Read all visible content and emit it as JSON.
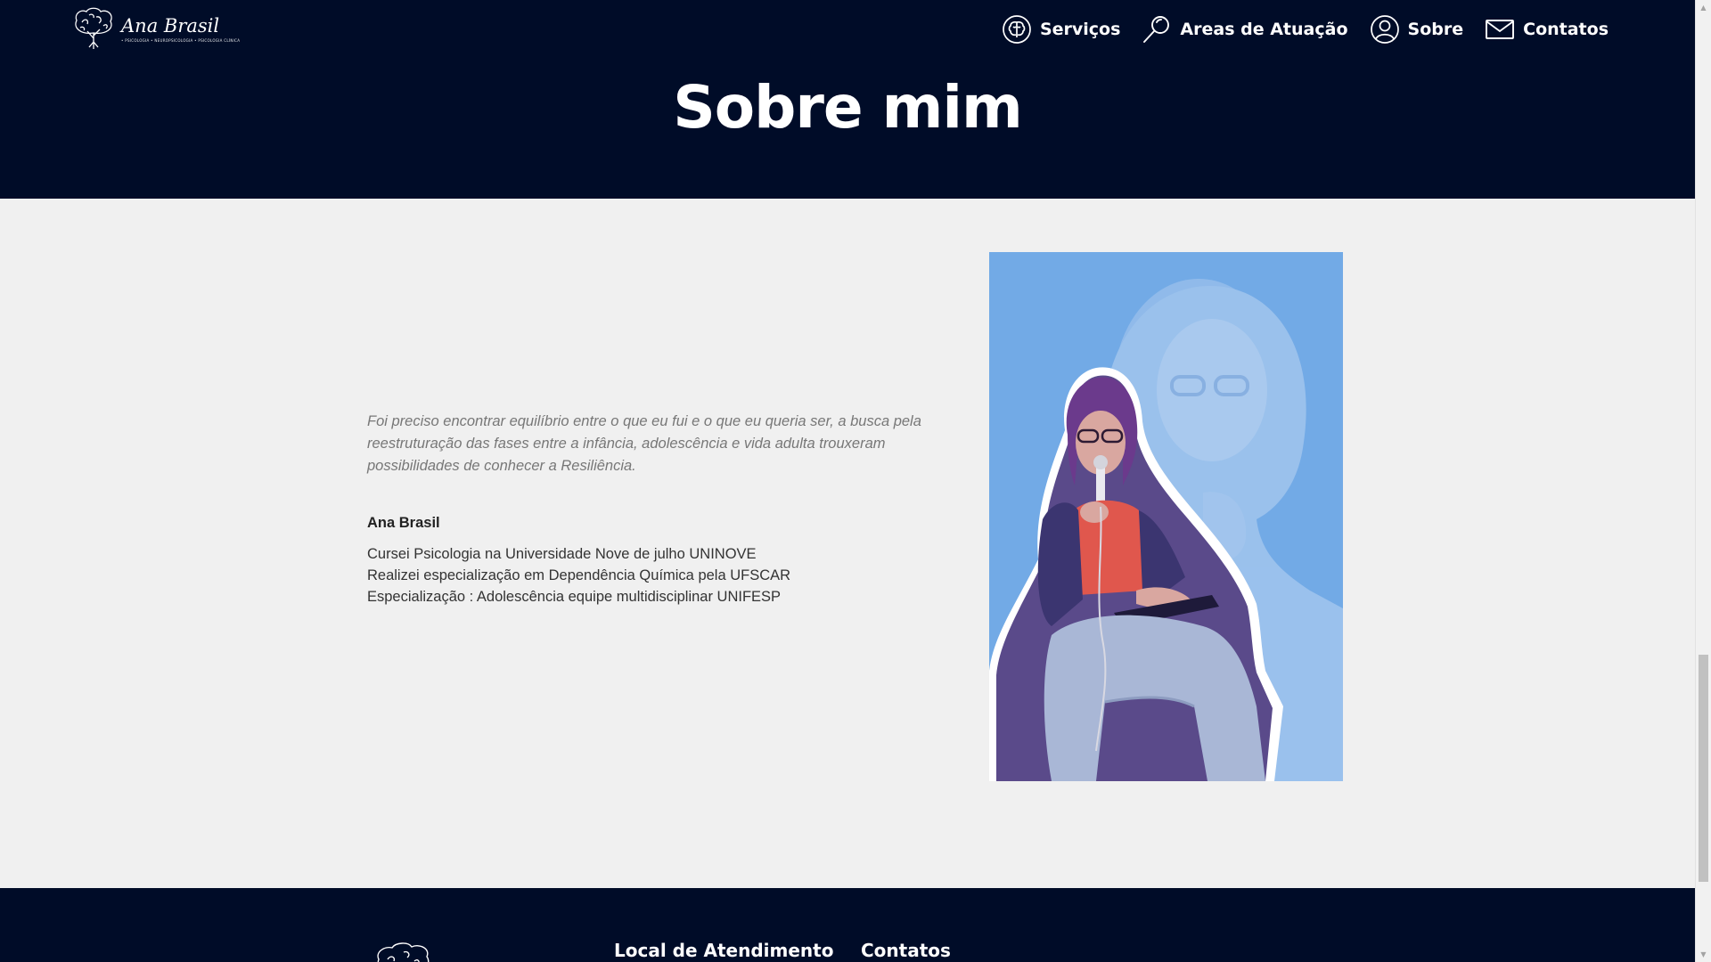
{
  "brand": {
    "name": "Ana Brasil",
    "tagline": "• PSICOLOGIA • NEUROPSICOLOGIA • PSICOLOGIA CLÍNICA"
  },
  "nav": {
    "items": [
      {
        "label": "Serviços",
        "icon": "brain-icon"
      },
      {
        "label": "Areas de Atuação",
        "icon": "search-icon"
      },
      {
        "label": "Sobre",
        "icon": "user-icon"
      },
      {
        "label": "Contatos",
        "icon": "mail-icon"
      }
    ]
  },
  "hero": {
    "title": "Sobre mim"
  },
  "about": {
    "quote": "Foi preciso encontrar equilíbrio entre o que eu fui e o que eu queria ser, a busca pela reestruturação das fases entre a infância, adolescência e vida adulta trouxeram possibilidades de conhecer a Resiliência.",
    "author": "Ana Brasil",
    "credentials": [
      "Cursei Psicologia na Universidade Nove de julho UNINOVE",
      "Realizei especialização em Dependência Química pela UFSCAR",
      "Especialização : Adolescência equipe multidisciplinar UNIFESP"
    ]
  },
  "footer": {
    "local_heading": "Local de Atendimento",
    "contact_heading": "Contatos"
  },
  "colors": {
    "navy": "#000c28",
    "background": "#f0f0f0",
    "photo_bg": "#72aae6"
  }
}
